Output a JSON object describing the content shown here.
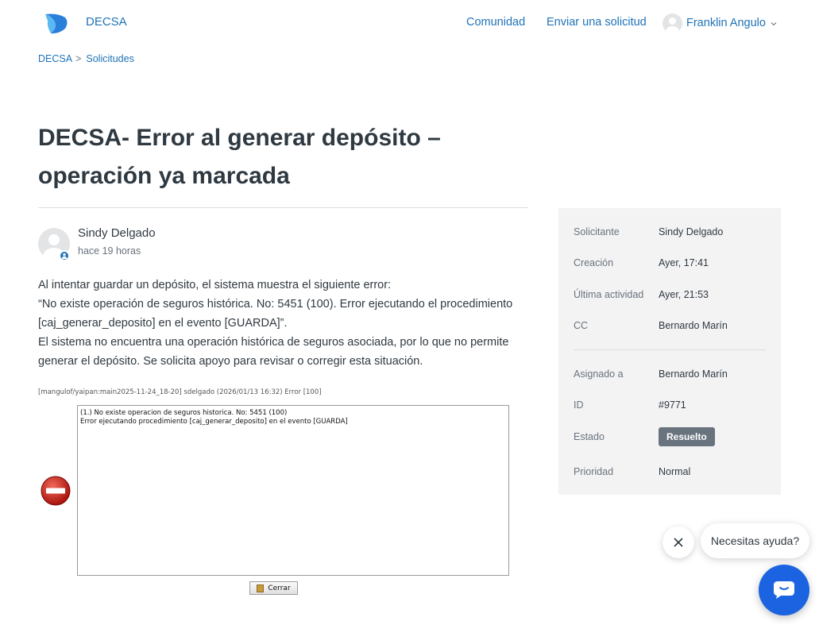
{
  "header": {
    "brand": "DECSA",
    "nav": {
      "community": "Comunidad",
      "submit_request": "Enviar una solicitud"
    },
    "user_name": "Franklin Angulo"
  },
  "breadcrumb": {
    "home": "DECSA",
    "separator": ">",
    "current": "Solicitudes"
  },
  "request": {
    "title": "DECSA- Error al generar depósito – operación ya marcada",
    "author": "Sindy Delgado",
    "time": "hace 19 horas",
    "body": [
      "Al intentar guardar un depósito, el sistema muestra el siguiente error:",
      "“No existe operación de seguros histórica. No: 5451 (100). Error ejecutando el procedimiento [caj_generar_deposito] en el evento [GUARDA]”.",
      "El sistema no encuentra una operación histórica de seguros asociada, por lo que no permite generar el depósito. Se solicita apoyo para revisar o corregir esta situación."
    ]
  },
  "screenshot": {
    "caption": "[mangulof/yaipan:main2025-11-24_18-20] sdelgado (2026/01/13 16:32) Error [100]",
    "error_lines": [
      "(1.) No existe operacion de seguros historica. No: 5451 (100)",
      "Error ejecutando procedimiento [caj_generar_deposito] en el evento [GUARDA]"
    ],
    "close_label": "Cerrar"
  },
  "sidebar": {
    "requester": {
      "label": "Solicitante",
      "value": "Sindy Delgado"
    },
    "created": {
      "label": "Creación",
      "value": "Ayer, 17:41"
    },
    "last_activity": {
      "label": "Última actividad",
      "value": "Ayer, 21:53"
    },
    "cc": {
      "label": "CC",
      "value": "Bernardo Marín"
    },
    "assignee": {
      "label": "Asignado a",
      "value": "Bernardo Marín"
    },
    "id": {
      "label": "ID",
      "value": "#9771"
    },
    "status": {
      "label": "Estado",
      "value": "Resuelto"
    },
    "priority": {
      "label": "Prioridad",
      "value": "Normal"
    }
  },
  "help": {
    "prompt": "Necesitas ayuda?"
  },
  "colors": {
    "link": "#1f73b7",
    "badge": "#68737d",
    "chat": "#1b63e0",
    "sidebar_bg": "#f3f3f4"
  }
}
